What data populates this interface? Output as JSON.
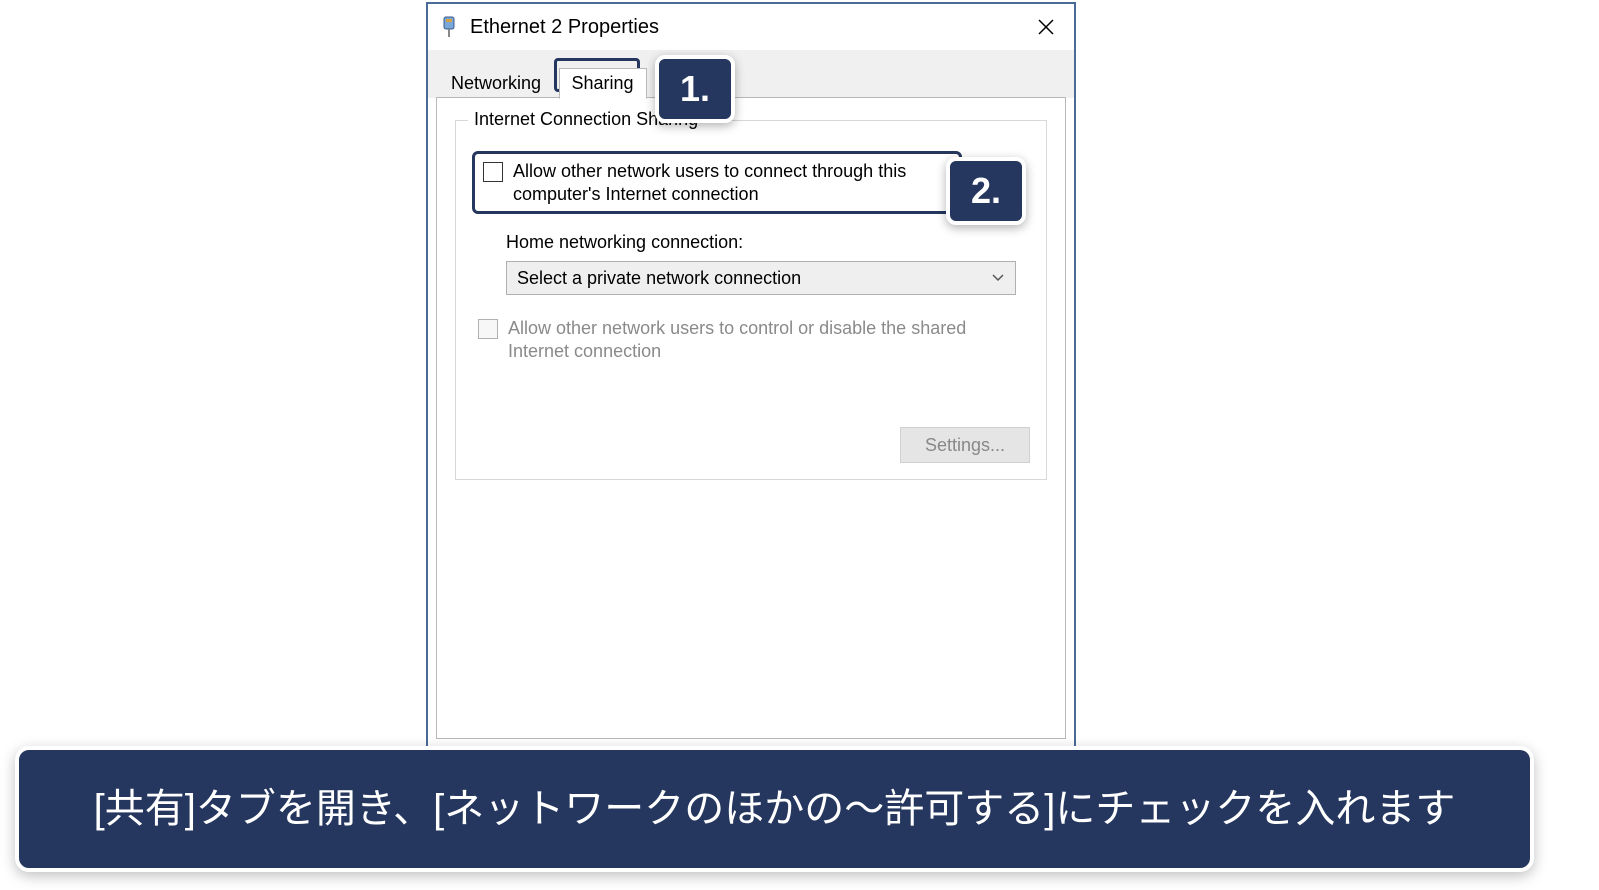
{
  "dialog": {
    "title": "Ethernet 2 Properties",
    "tabs": {
      "networking": "Networking",
      "sharing": "Sharing"
    },
    "group": {
      "legend": "Internet Connection Sharing",
      "allow_connect": "Allow other network users to connect through this computer's Internet connection",
      "home_label": "Home networking connection:",
      "dropdown_value": "Select a private network connection",
      "allow_control": "Allow other network users to control or disable the shared Internet connection",
      "settings_button": "Settings..."
    }
  },
  "callouts": {
    "one": "1.",
    "two": "2."
  },
  "caption": "[共有]タブを開き、[ネットワークのほかの～許可する]にチェックを入れます"
}
